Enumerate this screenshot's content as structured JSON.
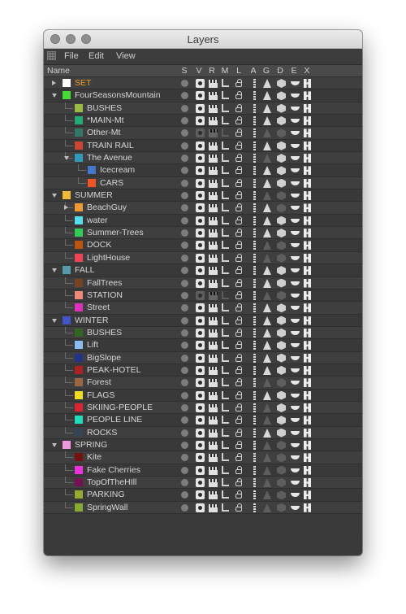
{
  "window": {
    "title": "Layers"
  },
  "menu": [
    "File",
    "Edit",
    "View"
  ],
  "header": {
    "name": "Name",
    "cols": [
      "S",
      "V",
      "R",
      "M",
      "L",
      "A",
      "G",
      "D",
      "E",
      "X"
    ]
  },
  "icons": {
    "S": "solo-dot-icon",
    "V": "visible-eye-icon",
    "R": "render-clapper-icon",
    "M": "manager-icon",
    "L": "lock-icon",
    "A": "animation-icon",
    "G": "generator-icon",
    "D": "deformer-icon",
    "E": "expression-icon",
    "X": "xref-icon"
  },
  "layers": [
    {
      "name": "SET",
      "color": "#ffffff",
      "depth": 0,
      "arrow": "right",
      "selected": true,
      "state": "on"
    },
    {
      "name": "FourSeasonsMountain",
      "color": "#44dd33",
      "depth": 0,
      "arrow": "down",
      "state": "on"
    },
    {
      "name": "BUSHES",
      "color": "#99bb44",
      "depth": 1,
      "state": "on"
    },
    {
      "name": "*MAIN-Mt",
      "color": "#22aa77",
      "depth": 1,
      "state": "on"
    },
    {
      "name": "Other-Mt",
      "color": "#337766",
      "depth": 1,
      "state": "off"
    },
    {
      "name": "TRAIN RAIL",
      "color": "#cc4433",
      "depth": 1,
      "state": "on"
    },
    {
      "name": "The Avenue",
      "color": "#3399bb",
      "depth": 1,
      "arrow": "down",
      "state": "on"
    },
    {
      "name": "Icecream",
      "color": "#4477cc",
      "depth": 2,
      "state": "on"
    },
    {
      "name": "CARS",
      "color": "#ee5522",
      "depth": 2,
      "state": "on"
    },
    {
      "name": "SUMMER",
      "color": "#eebb33",
      "depth": 0,
      "arrow": "down",
      "state": "on"
    },
    {
      "name": "BeachGuy",
      "color": "#ee9933",
      "depth": 1,
      "arrow": "right",
      "state": "on"
    },
    {
      "name": "water",
      "color": "#55ddee",
      "depth": 1,
      "state": "on"
    },
    {
      "name": "Summer-Trees",
      "color": "#33cc55",
      "depth": 1,
      "state": "on"
    },
    {
      "name": "DOCK",
      "color": "#bb5511",
      "depth": 1,
      "state": "on"
    },
    {
      "name": "LightHouse",
      "color": "#ee4455",
      "depth": 1,
      "state": "on"
    },
    {
      "name": "FALL",
      "color": "#5599aa",
      "depth": 0,
      "arrow": "down",
      "state": "on"
    },
    {
      "name": "FallTrees",
      "color": "#774422",
      "depth": 1,
      "state": "on"
    },
    {
      "name": "STATION",
      "color": "#ee8877",
      "depth": 1,
      "state": "off"
    },
    {
      "name": "Street",
      "color": "#dd33bb",
      "depth": 1,
      "state": "on"
    },
    {
      "name": "WINTER",
      "color": "#4455cc",
      "depth": 0,
      "arrow": "down",
      "state": "on"
    },
    {
      "name": "BUSHES",
      "color": "#336622",
      "depth": 1,
      "state": "on"
    },
    {
      "name": "Lift",
      "color": "#88bbee",
      "depth": 1,
      "state": "on"
    },
    {
      "name": "BigSlope",
      "color": "#223388",
      "depth": 1,
      "state": "on"
    },
    {
      "name": "PEAK-HOTEL",
      "color": "#aa2222",
      "depth": 1,
      "state": "on"
    },
    {
      "name": "Forest",
      "color": "#996644",
      "depth": 1,
      "state": "on"
    },
    {
      "name": "FLAGS",
      "color": "#eedd22",
      "depth": 1,
      "state": "on"
    },
    {
      "name": "SKIING-PEOPLE",
      "color": "#dd2233",
      "depth": 1,
      "state": "on"
    },
    {
      "name": "PEOPLE LINE",
      "color": "#22ddbb",
      "depth": 1,
      "state": "on"
    },
    {
      "name": "ROCKS",
      "color": "#334455",
      "depth": 1,
      "state": "on"
    },
    {
      "name": "SPRING",
      "color": "#ee99dd",
      "depth": 0,
      "arrow": "down",
      "state": "on"
    },
    {
      "name": "Kite",
      "color": "#771111",
      "depth": 1,
      "state": "on"
    },
    {
      "name": "Fake Cherries",
      "color": "#ee33dd",
      "depth": 1,
      "state": "on"
    },
    {
      "name": "TopOfTheHIll",
      "color": "#771155",
      "depth": 1,
      "state": "on"
    },
    {
      "name": "PARKING",
      "color": "#99aa33",
      "depth": 1,
      "state": "on"
    },
    {
      "name": "SpringWall",
      "color": "#88aa33",
      "depth": 1,
      "state": "on"
    }
  ]
}
